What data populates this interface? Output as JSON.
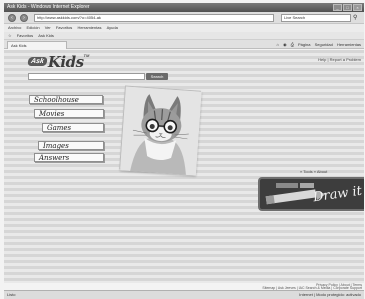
{
  "browser": {
    "title": "Ask Kids - Windows Internet Explorer",
    "url": "http://www.askkids.com/?o=4054-ak",
    "search_placeholder": "Live Search",
    "menu": [
      "Archivo",
      "Edición",
      "Ver",
      "Favoritos",
      "Herramientas",
      "Ayuda"
    ],
    "favorites": [
      "Favoritos",
      "Ask Kids"
    ],
    "tab": "Ask Kids",
    "commands": [
      "Página",
      "Seguridad",
      "Herramientas"
    ]
  },
  "page": {
    "toplinks": "Help | Report a Problem",
    "logo_ask": "Ask",
    "logo_kids": "Kids",
    "logo_tm": "TM",
    "search_button": "Search",
    "nav": [
      {
        "label": "Schoolhouse"
      },
      {
        "label": "Movies"
      },
      {
        "label": "Games"
      },
      {
        "label": "Images"
      },
      {
        "label": "Answers"
      }
    ],
    "tool_links": "» Tools » About",
    "drawit_label": "Draw it",
    "footer_line1": "Privacy Policy | About | Terms",
    "footer_line2": "Sitemap | Ask Jeeves | IAC Search & Media | Corporate Support"
  },
  "status": {
    "left": "Listo",
    "right": "Internet | Modo protegido: activado"
  }
}
